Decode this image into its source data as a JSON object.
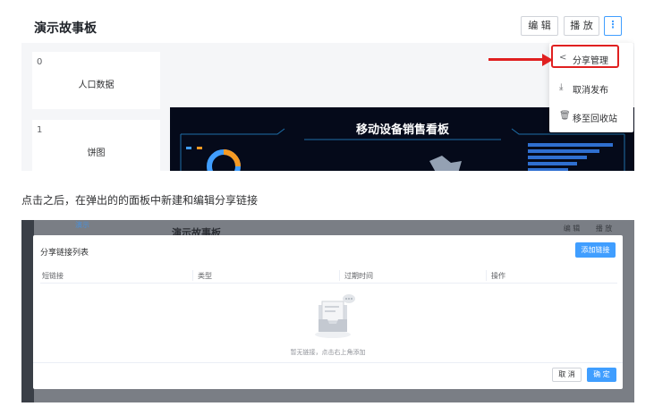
{
  "top": {
    "title": "演示故事板",
    "edit_label": "编 辑",
    "play_label": "播 放",
    "more_label": "⋮",
    "cards": [
      {
        "index": "0",
        "label": "人口数据"
      },
      {
        "index": "1",
        "label": "饼图"
      }
    ],
    "dashboard_title": "移动设备销售看板",
    "menu": [
      {
        "icon": "share-icon",
        "glyph": "<",
        "label": "分享管理"
      },
      {
        "icon": "download-icon",
        "glyph": "⤓",
        "label": "取消发布"
      },
      {
        "icon": "trash-icon",
        "glyph": "🗑",
        "label": "移至回收站"
      }
    ]
  },
  "caption": "点击之后，在弹出的的面板中新建和编辑分享链接",
  "bottom": {
    "bg_title": "演示故事板",
    "bg_nav": "演示",
    "bg_edit": "编 辑",
    "bg_play": "播 放",
    "dialog": {
      "title": "分享链接列表",
      "add_label": "添加链接",
      "columns": [
        "短链接",
        "类型",
        "过期时间",
        "操作"
      ],
      "empty_text": "暂无链接，点击右上角添加",
      "cancel_label": "取 消",
      "confirm_label": "确 定"
    }
  },
  "colors": {
    "primary": "#409eff",
    "highlight": "#e02020",
    "dashboard_bg": "#050a1a"
  }
}
